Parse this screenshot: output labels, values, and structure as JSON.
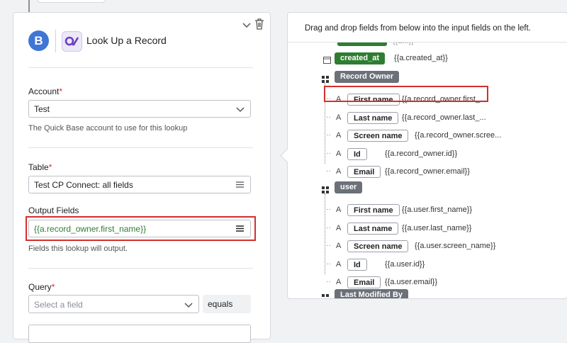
{
  "card": {
    "avatar_letter": "B",
    "title": "Look Up a Record",
    "account": {
      "label": "Account",
      "required_mark": "*",
      "value": "Test",
      "help": "The Quick Base account to use for this lookup"
    },
    "table": {
      "label": "Table",
      "required_mark": "*",
      "value": "Test CP Connect: all fields"
    },
    "output": {
      "label": "Output Fields",
      "value": "{{a.record_owner.first_name}}",
      "help": "Fields this lookup will output."
    },
    "query": {
      "label": "Query",
      "required_mark": "*",
      "field_placeholder": "Select a field",
      "operator": "equals"
    }
  },
  "panel": {
    "title": "Drag and drop fields from below into the input fields on the left.",
    "partial_token": "{{a...}}",
    "created_at": {
      "tag": "created_at",
      "token": "{{a.created_at}}"
    },
    "groups": [
      {
        "name": "Record Owner",
        "fields": [
          {
            "type": "A",
            "name": "First name",
            "token": "{{a.record_owner.first_..."
          },
          {
            "type": "A",
            "name": "Last name",
            "token": "{{a.record_owner.last_..."
          },
          {
            "type": "A",
            "name": "Screen name",
            "token": "{{a.record_owner.scree..."
          },
          {
            "type": "A",
            "name": "Id",
            "token": "{{a.record_owner.id}}"
          },
          {
            "type": "A",
            "name": "Email",
            "token": "{{a.record_owner.email}}"
          }
        ]
      },
      {
        "name": "user",
        "fields": [
          {
            "type": "A",
            "name": "First name",
            "token": "{{a.user.first_name}}"
          },
          {
            "type": "A",
            "name": "Last name",
            "token": "{{a.user.last_name}}"
          },
          {
            "type": "A",
            "name": "Screen name",
            "token": "{{a.user.screen_name}}"
          },
          {
            "type": "A",
            "name": "Id",
            "token": "{{a.user.id}}"
          },
          {
            "type": "A",
            "name": "Email",
            "token": "{{a.user.email}}"
          }
        ]
      },
      {
        "name": "Last Modified By",
        "fields": []
      }
    ]
  },
  "colors": {
    "highlight": "#d32f2f",
    "avatar": "#3f76d6",
    "green_tag": "#2e7d32",
    "gray_tag": "#6b7079"
  },
  "icons": [
    "chevron-down-icon",
    "trash-icon",
    "app-logo-icon",
    "caret-down-icon",
    "list-lines-icon",
    "calendar-icon",
    "grid-icon"
  ]
}
